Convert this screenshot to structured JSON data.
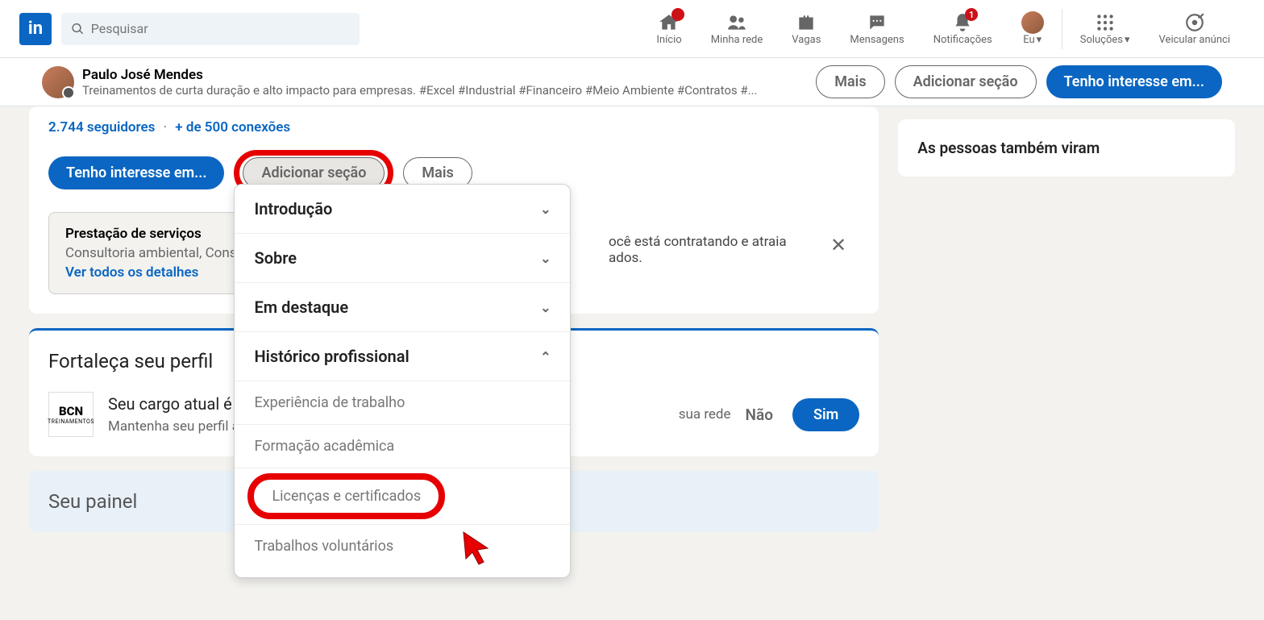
{
  "search": {
    "placeholder": "Pesquisar"
  },
  "nav": {
    "home": "Início",
    "network": "Minha rede",
    "jobs": "Vagas",
    "messages": "Mensagens",
    "notifications": "Notificações",
    "notif_count": "1",
    "me": "Eu",
    "solutions": "Soluções",
    "advertise": "Veicular anúnci"
  },
  "sticky": {
    "name": "Paulo José Mendes",
    "headline": "Treinamentos de curta duração e alto impacto para empresas. #Excel #Industrial #Financeiro #Meio Ambiente #Contratos #...",
    "more": "Mais",
    "add_section": "Adicionar seção",
    "interest": "Tenho interesse em..."
  },
  "profile": {
    "followers": "2.744 seguidores",
    "connections": "+ de 500 conexões",
    "interest": "Tenho interesse em...",
    "add_section": "Adicionar seção",
    "more": "Mais"
  },
  "services": {
    "title": "Prestação de serviços",
    "sub": "Consultoria ambiental, Consu",
    "link": "Ver todos os detalhes"
  },
  "hiring": {
    "text1": "ocê está contratando",
    "text2": " e atraia",
    "text3": "ados."
  },
  "dropdown": {
    "intro": "Introdução",
    "about": "Sobre",
    "featured": "Em destaque",
    "history": "Histórico profissional",
    "work_exp": "Experiência de trabalho",
    "education": "Formação acadêmica",
    "licenses": "Licenças e certificados",
    "volunteer": "Trabalhos voluntários"
  },
  "strengthen": {
    "title": "Fortaleça seu perfil",
    "logo_main": "BCN",
    "logo_sub": "TREINAMENTOS",
    "question": "Seu cargo atual é",
    "hint_left": "Mantenha seu perfil a",
    "hint_right": " sua rede",
    "no": "Não",
    "yes": "Sim"
  },
  "panel": {
    "title": "Seu painel"
  },
  "side": {
    "title": "As pessoas também viram"
  }
}
